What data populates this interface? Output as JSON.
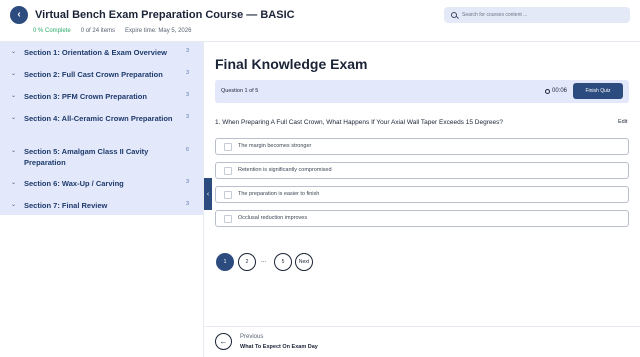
{
  "header": {
    "title": "Virtual Bench Exam Preparation Course — BASIC",
    "progress_text": "0 % Complete",
    "items_text": "0 of 24 items",
    "expire_text": "Expire time: May 5, 2026",
    "back_icon": "‹"
  },
  "search": {
    "placeholder": "Search for courses content ..."
  },
  "sidebar": {
    "sections": [
      {
        "label": "Section 1: Orientation & Exam Overview",
        "count": "3"
      },
      {
        "label": "Section 2: Full Cast Crown Preparation",
        "count": "3"
      },
      {
        "label": "Section 3: PFM Crown Preparation",
        "count": "3"
      },
      {
        "label": "Section 4: All-Ceramic Crown Preparation",
        "count": "3"
      },
      {
        "label": "Section 5: Amalgam Class II Cavity Preparation",
        "count": "6"
      },
      {
        "label": "Section 6: Wax-Up / Carving",
        "count": "3"
      },
      {
        "label": "Section 7: Final Review",
        "count": "3"
      }
    ],
    "chevron": "⌄",
    "toggle": "‹"
  },
  "main": {
    "title": "Final Knowledge Exam",
    "question_count": "Question 1 of 5",
    "timer": "00:06",
    "finish_label": "Finish Quiz",
    "question": "1. When Preparing A Full Cast Crown, What Happens If Your Axial Wall Taper Exceeds 15 Degrees?",
    "edit_label": "Edit",
    "options": [
      "The margin becomes stronger",
      "Retention is significantly compromised",
      "The preparation is easier to finish",
      "Occlusal reduction improves"
    ],
    "pagination": {
      "pages": [
        "1",
        "2",
        "5"
      ],
      "ellipsis": "...",
      "next": "Next",
      "current": "1"
    },
    "previous": {
      "label": "Previous",
      "title": "What To Expect On Exam Day",
      "icon": "←"
    }
  },
  "colors": {
    "accent": "#2c4b7e",
    "sidebar_bg": "#e3e9fb",
    "complete": "#2eab6b"
  }
}
